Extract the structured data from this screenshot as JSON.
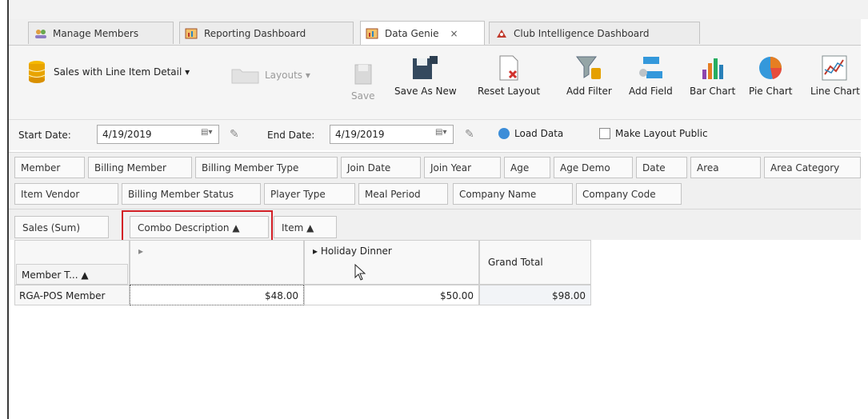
{
  "tabs": [
    {
      "label": "Manage Members",
      "icon": "members-icon"
    },
    {
      "label": "Reporting Dashboard",
      "icon": "report-icon"
    },
    {
      "label": "Data Genie",
      "icon": "data-genie-icon",
      "active": true,
      "close": "×"
    },
    {
      "label": "Club Intelligence Dashboard",
      "icon": "intelligence-icon"
    }
  ],
  "ribbon": {
    "report_selector": "Sales with Line Item Detail ▾",
    "layouts": "Layouts ▾",
    "save": "Save",
    "save_as_new": "Save As New",
    "reset_layout": "Reset Layout",
    "add_filter": "Add Filter",
    "add_field": "Add Field",
    "bar_chart": "Bar Chart",
    "pie_chart": "Pie Chart",
    "line_chart": "Line Chart"
  },
  "dates": {
    "start_label": "Start Date:",
    "start_value": "4/19/2019",
    "end_label": "End Date:",
    "end_value": "4/19/2019",
    "load_data": "Load Data",
    "make_public": "Make Layout Public"
  },
  "fields_row1": [
    "Member",
    "Billing Member",
    "Billing Member Type",
    "Join Date",
    "Join Year",
    "Age",
    "Age Demo",
    "Date",
    "Area",
    "Area Category"
  ],
  "fields_row2": [
    "Item Vendor",
    "Billing Member Status",
    "Player Type",
    "Meal Period",
    "Company Name",
    "Company Code"
  ],
  "data_header": {
    "sales_sum": "Sales (Sum)",
    "combo_description": "Combo Description ▲",
    "item": "Item ▲"
  },
  "grid": {
    "row_header": "Member T... ▲",
    "col1_header": "▸",
    "col2_header": "▸  Holiday Dinner",
    "grand_total_header": "Grand Total",
    "rows": [
      {
        "label": "RGA-POS Member",
        "col1": "$48.00",
        "col2": "$50.00",
        "total": "$98.00"
      }
    ]
  }
}
